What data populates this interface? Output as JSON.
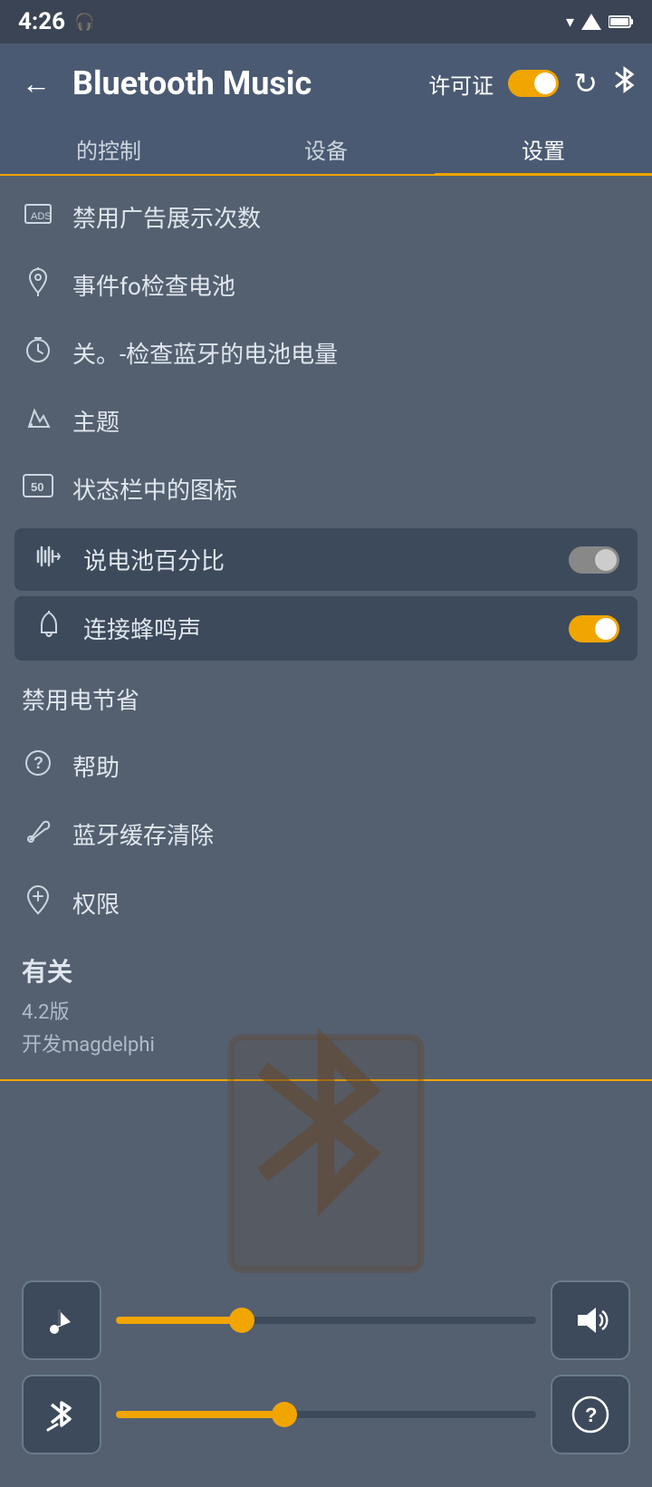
{
  "statusBar": {
    "time": "4:26",
    "headphonesIcon": "🎧",
    "wifiIcon": "▼",
    "signalIcon": "▲",
    "batteryIcon": "🔋"
  },
  "header": {
    "backLabel": "←",
    "title": "Bluetooth Music",
    "licenseLabel": "许可证",
    "refreshLabel": "↻",
    "bluetoothLabel": "⊁"
  },
  "tabs": [
    {
      "id": "control",
      "label": "的控制",
      "active": false
    },
    {
      "id": "devices",
      "label": "设备",
      "active": false
    },
    {
      "id": "settings",
      "label": "设置",
      "active": true
    }
  ],
  "settingsItems": [
    {
      "id": "ads",
      "icon": "📋",
      "text": "禁用广告展示次数"
    },
    {
      "id": "event",
      "icon": "🔔",
      "text": "事件fo检查电池"
    },
    {
      "id": "timer",
      "icon": "⏰",
      "text": "关。-检查蓝牙的电池电量"
    },
    {
      "id": "theme",
      "icon": "🖌",
      "text": "主题"
    },
    {
      "id": "statusbar",
      "icon": "🔢",
      "text": "状态栏中的图标"
    }
  ],
  "toggleItems": [
    {
      "id": "battery-percent",
      "text": "说电池百分比",
      "on": false
    },
    {
      "id": "connect-beep",
      "text": "连接蜂鸣声",
      "on": true
    }
  ],
  "extraItems": [
    {
      "id": "disable-power",
      "text": "禁用电节省",
      "hasIcon": false
    },
    {
      "id": "help",
      "icon": "❓",
      "text": "帮助"
    },
    {
      "id": "bt-cache",
      "icon": "🔧",
      "text": "蓝牙缓存清除"
    },
    {
      "id": "permissions",
      "icon": "➕",
      "text": "权限"
    }
  ],
  "about": {
    "title": "有关",
    "version": "4.2版",
    "developer": "开发magdelphi"
  },
  "player": {
    "musicIcon": "♪",
    "volumeIcon": "🔊",
    "bluetoothIcon": "⊁",
    "helpIcon": "?",
    "musicSliderPercent": 30,
    "btSliderPercent": 40
  }
}
